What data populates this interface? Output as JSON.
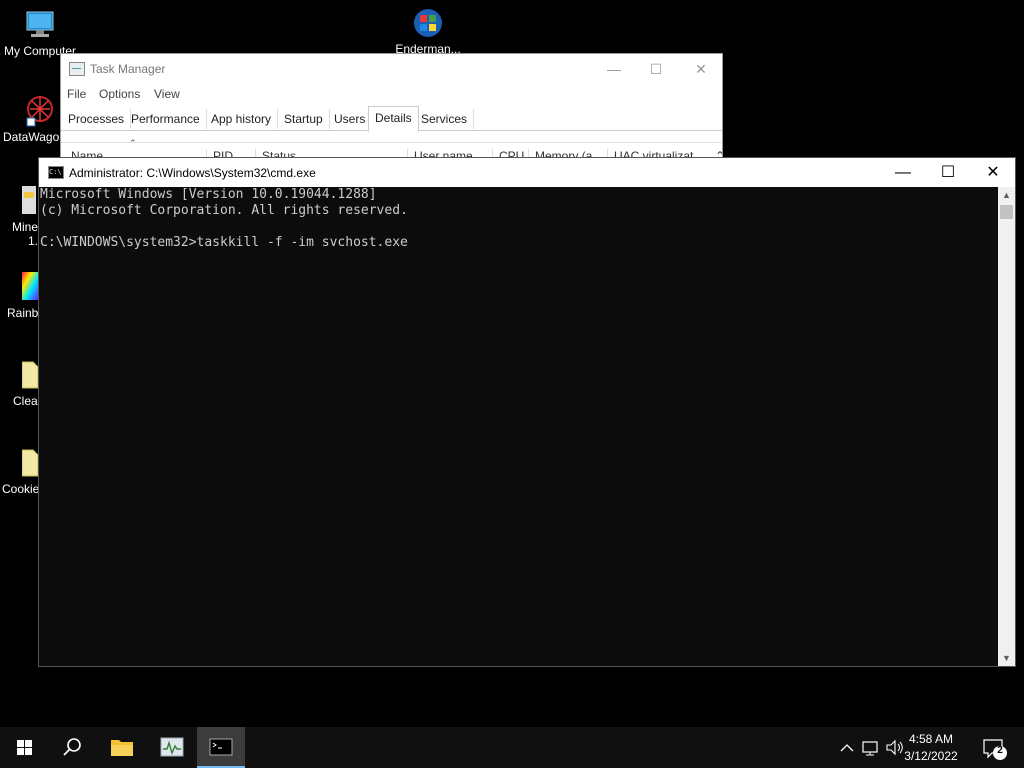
{
  "desktop": {
    "icons": [
      {
        "label": "My Computer"
      },
      {
        "label": "Enderman..."
      },
      {
        "label": "DataWago"
      },
      {
        "label": "Mine"
      },
      {
        "label": "Rainb"
      },
      {
        "label": "Clean"
      },
      {
        "label": "Cookie"
      }
    ],
    "partial_text": "1."
  },
  "task_manager": {
    "title": "Task Manager",
    "minimize": "—",
    "maximize": "☐",
    "close": "✕",
    "menu": [
      "File",
      "Options",
      "View"
    ],
    "tabs": [
      "Processes",
      "Performance",
      "App history",
      "Startup",
      "Users",
      "Details",
      "Services"
    ],
    "active_tab": "Details",
    "columns": [
      "Name",
      "PID",
      "Status",
      "User name",
      "CPU",
      "Memory (a...",
      "UAC virtualizat..."
    ]
  },
  "cmd": {
    "title": "Administrator: C:\\Windows\\System32\\cmd.exe",
    "icon_text": "C:\\",
    "minimize": "—",
    "maximize": "☐",
    "close": "✕",
    "lines": [
      "Microsoft Windows [Version 10.0.19044.1288]",
      "(c) Microsoft Corporation. All rights reserved.",
      "",
      "C:\\WINDOWS\\system32>taskkill -f -im svchost.exe"
    ]
  },
  "taskbar": {
    "clock_time": "4:58 AM",
    "clock_date": "3/12/2022",
    "notification_count": "2",
    "accent_color": "#76b9ed"
  }
}
